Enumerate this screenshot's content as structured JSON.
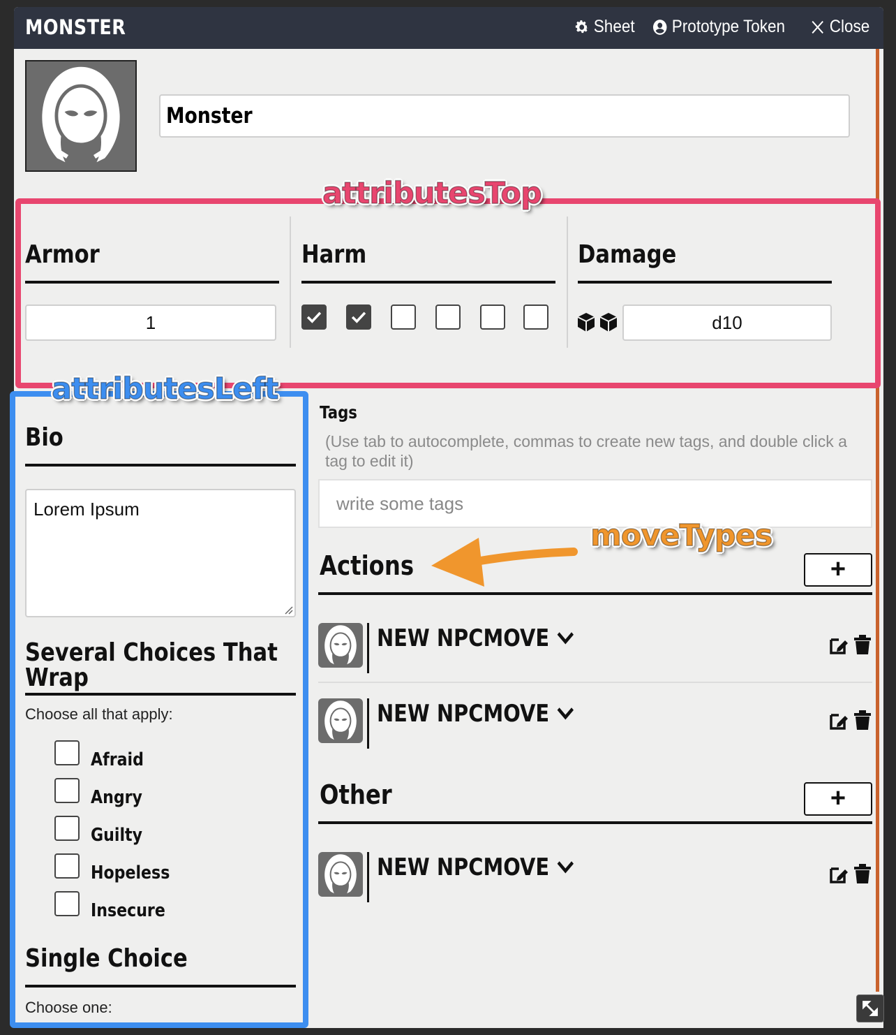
{
  "window": {
    "title": "MONSTER",
    "header_buttons": [
      {
        "label": "Sheet",
        "icon": "gear-icon"
      },
      {
        "label": "Prototype Token",
        "icon": "user-circle-icon"
      },
      {
        "label": "Close",
        "icon": "close-icon"
      }
    ]
  },
  "actor": {
    "name": "Monster",
    "portrait_icon": "hooded-figure-icon"
  },
  "annotations": {
    "top": {
      "label": "attributesTop",
      "color": "#e8466f"
    },
    "left": {
      "label": "attributesLeft",
      "color": "#3d8ef0"
    },
    "moves": {
      "label": "moveTypes",
      "color": "#f0962d"
    }
  },
  "attributes_top": {
    "armor": {
      "label": "Armor",
      "value": "1"
    },
    "harm": {
      "label": "Harm",
      "checks": [
        true,
        true,
        false,
        false,
        false,
        false
      ]
    },
    "damage": {
      "label": "Damage",
      "value": "d10",
      "icon": "dice-icon"
    }
  },
  "attributes_left": {
    "bio": {
      "label": "Bio",
      "value": "Lorem Ipsum"
    },
    "several": {
      "label_line1": "Several Choices That",
      "label_line2": "Wrap",
      "instruction": "Choose all that apply:",
      "options": [
        "Afraid",
        "Angry",
        "Guilty",
        "Hopeless",
        "Insecure"
      ]
    },
    "single": {
      "label": "Single Choice",
      "instruction": "Choose one:"
    }
  },
  "tags": {
    "label": "Tags",
    "help_line1": "(Use tab to autocomplete, commas to create new tags, and double click a",
    "help_line2": "tag to edit it)",
    "placeholder": "write some tags"
  },
  "move_types": [
    {
      "label": "Actions",
      "add_label": "+",
      "moves": [
        "NEW NPCMOVE",
        "NEW NPCMOVE"
      ]
    },
    {
      "label": "Other",
      "add_label": "+",
      "moves": [
        "NEW NPCMOVE"
      ]
    }
  ]
}
